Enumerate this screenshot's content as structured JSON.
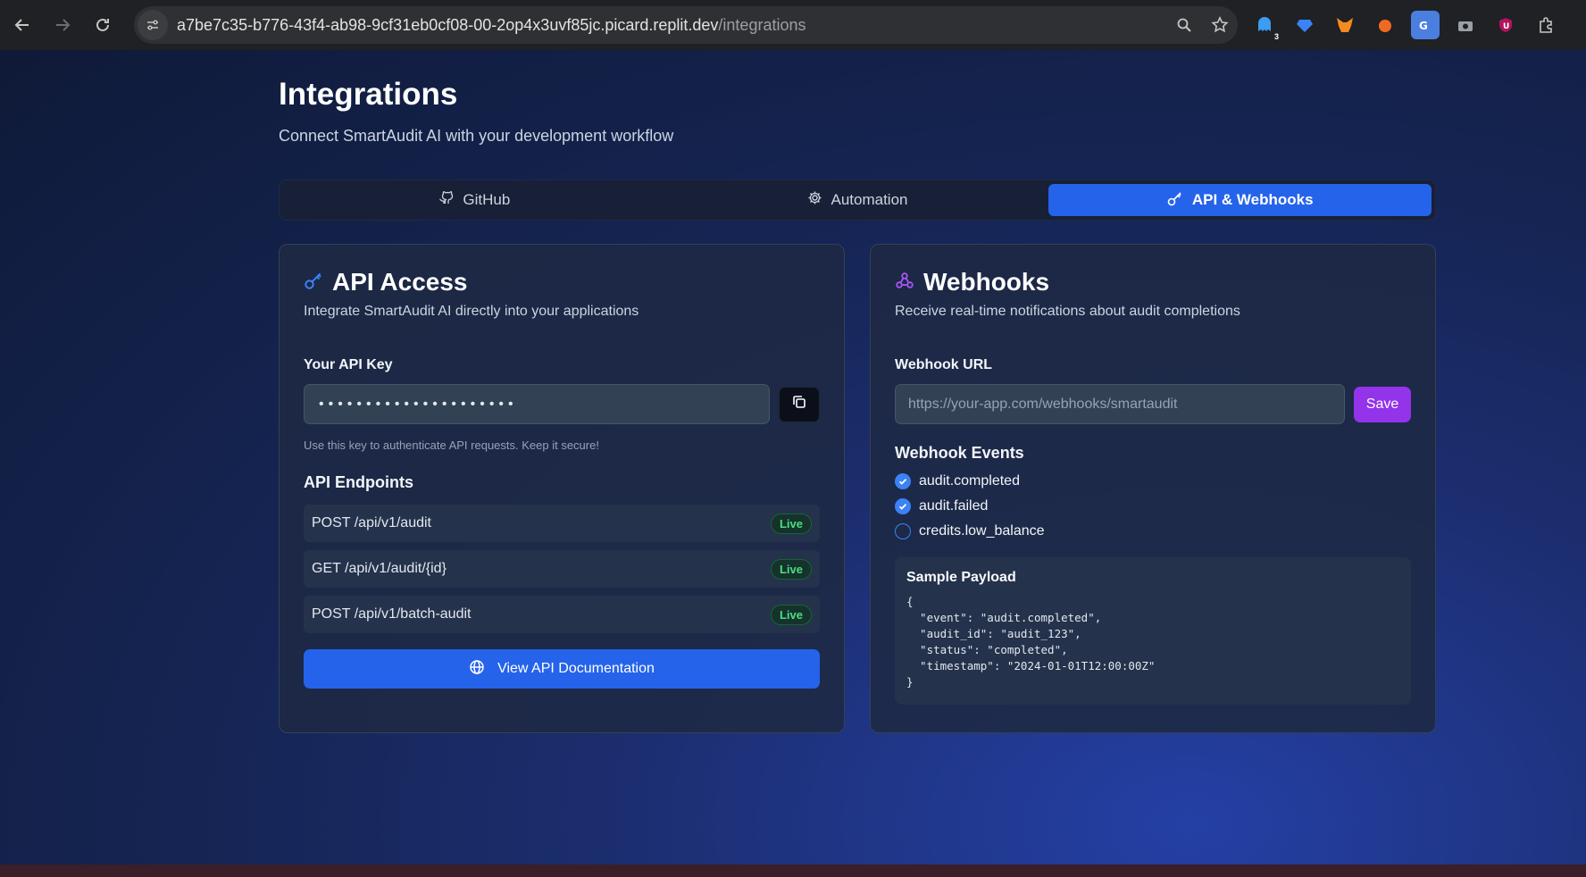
{
  "browser": {
    "url_host": "a7be7c35-b776-43f4-ab98-9cf31eb0cf08-00-2op4x3uvf85jc.picard.replit.dev",
    "url_path": "/integrations",
    "extension_badge": "3"
  },
  "header": {
    "title": "Integrations",
    "subtitle": "Connect SmartAudit AI with your development workflow"
  },
  "tabs": [
    {
      "label": "GitHub",
      "icon": "github-icon",
      "active": false
    },
    {
      "label": "Automation",
      "icon": "gear-icon",
      "active": false
    },
    {
      "label": "API & Webhooks",
      "icon": "key-icon",
      "active": true
    }
  ],
  "api": {
    "title": "API Access",
    "description": "Integrate SmartAudit AI directly into your applications",
    "key_label": "Your API Key",
    "key_value": "•••••••••••••••••••••",
    "hint": "Use this key to authenticate API requests. Keep it secure!",
    "endpoints_title": "API Endpoints",
    "endpoints": [
      {
        "path": "POST /api/v1/audit",
        "status": "Live"
      },
      {
        "path": "GET /api/v1/audit/{id}",
        "status": "Live"
      },
      {
        "path": "POST /api/v1/batch-audit",
        "status": "Live"
      }
    ],
    "docs_button": "View API Documentation"
  },
  "webhooks": {
    "title": "Webhooks",
    "description": "Receive real-time notifications about audit completions",
    "url_label": "Webhook URL",
    "url_placeholder": "https://your-app.com/webhooks/smartaudit",
    "save_button": "Save",
    "events_title": "Webhook Events",
    "events": [
      {
        "name": "audit.completed",
        "checked": true
      },
      {
        "name": "audit.failed",
        "checked": true
      },
      {
        "name": "credits.low_balance",
        "checked": false
      }
    ],
    "payload_title": "Sample Payload",
    "payload_code": "{\n  \"event\": \"audit.completed\",\n  \"audit_id\": \"audit_123\",\n  \"status\": \"completed\",\n  \"timestamp\": \"2024-01-01T12:00:00Z\"\n}"
  },
  "colors": {
    "accent": "#2563eb",
    "purple": "#9333ea",
    "live_green": "#4ade80"
  }
}
